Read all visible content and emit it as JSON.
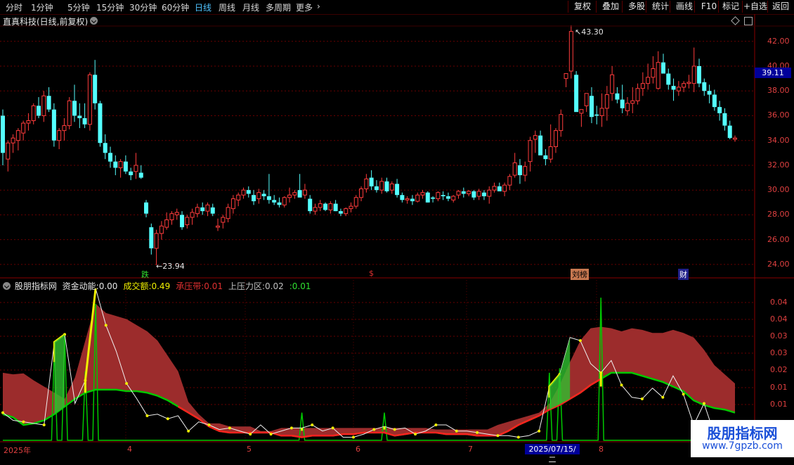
{
  "period_bar": {
    "periods": [
      "分时",
      "1分钟",
      "5分钟",
      "15分钟",
      "30分钟",
      "60分钟",
      "日线",
      "周线",
      "月线",
      "多周期",
      "更多"
    ],
    "active": "日线",
    "right_buttons": [
      "复权",
      "叠加",
      "多股",
      "统计",
      "画线",
      "F10",
      "标记",
      "+自选",
      "返回"
    ]
  },
  "stock": {
    "title": "直真科技(日线,前复权)"
  },
  "price_axis": {
    "ticks": [
      "42.00",
      "40.00",
      "38.00",
      "36.00",
      "34.00",
      "32.00",
      "30.00",
      "28.00",
      "26.00",
      "24.00"
    ],
    "current": "39.11"
  },
  "annotations": {
    "high": "43.30",
    "low": "23.94"
  },
  "events": [
    "跌",
    "$",
    "刘榜",
    "财"
  ],
  "indicator": {
    "name": "股朋指标网",
    "fields": [
      {
        "label": "资金动能:",
        "value": "0.00",
        "color": "#e6e6e6"
      },
      {
        "label": "成交额:",
        "value": "0.49",
        "color": "#f0f000"
      },
      {
        "label": "承压带:",
        "value": "0.01",
        "color": "#e03030"
      },
      {
        "label": "上压力区:",
        "value": "0.02",
        "color": "#c0c0c0"
      },
      {
        "label": ":",
        "value": "0.01",
        "color": "#30e030"
      }
    ],
    "axis_ticks": [
      "0.04",
      "0.04",
      "0.03",
      "0.03",
      "0.02",
      "0.01",
      "0.01"
    ]
  },
  "time_axis": {
    "labels": [
      "2025年",
      "4",
      "5",
      "6",
      "7",
      "8"
    ],
    "cursor_date": "2025/07/15/二"
  },
  "watermark": {
    "title": "股朋指标网",
    "url": "www.7gpzb.com"
  },
  "colors": {
    "up": "#ff3c3c",
    "down": "#54ffff",
    "band": "#9c2c2c",
    "support": "#00c800",
    "zero": "#ff2020",
    "volume": "#f0f000"
  },
  "chart_data": {
    "type": "candlestick",
    "ylim": [
      23.2,
      44.2
    ],
    "ohlc": [
      [
        36.0,
        36.5,
        32.0,
        33.0
      ],
      [
        32.5,
        34.0,
        31.5,
        33.8
      ],
      [
        33.8,
        34.5,
        33.0,
        34.2
      ],
      [
        34.0,
        35.0,
        33.2,
        34.8
      ],
      [
        34.6,
        35.6,
        34.0,
        35.4
      ],
      [
        35.4,
        36.2,
        34.8,
        35.6
      ],
      [
        35.6,
        37.0,
        35.3,
        36.8
      ],
      [
        36.8,
        37.5,
        35.8,
        36.0
      ],
      [
        36.0,
        38.0,
        35.5,
        37.6
      ],
      [
        37.6,
        38.3,
        36.3,
        36.5
      ],
      [
        36.5,
        37.0,
        33.5,
        34.0
      ],
      [
        34.0,
        35.0,
        33.3,
        34.8
      ],
      [
        34.8,
        35.8,
        34.0,
        35.2
      ],
      [
        35.2,
        37.5,
        34.9,
        37.2
      ],
      [
        37.2,
        38.5,
        35.5,
        36.0
      ],
      [
        36.0,
        37.0,
        35.0,
        35.8
      ],
      [
        35.8,
        37.0,
        35.0,
        35.3
      ],
      [
        35.3,
        39.5,
        34.8,
        39.3
      ],
      [
        39.3,
        40.5,
        36.5,
        37.0
      ],
      [
        37.0,
        37.2,
        33.5,
        33.8
      ],
      [
        33.8,
        34.5,
        32.5,
        33.0
      ],
      [
        33.0,
        33.5,
        31.8,
        32.3
      ],
      [
        32.3,
        32.8,
        31.2,
        31.8
      ],
      [
        31.8,
        32.5,
        31.0,
        32.3
      ],
      [
        32.3,
        32.8,
        31.3,
        31.5
      ],
      [
        31.5,
        31.8,
        30.8,
        31.2
      ],
      [
        31.5,
        33.0,
        30.9,
        32.0
      ],
      [
        31.4,
        32.0,
        30.9,
        31.0
      ],
      [
        29.0,
        29.2,
        27.8,
        28.1
      ],
      [
        27.0,
        27.3,
        24.8,
        25.3
      ],
      [
        25.3,
        26.8,
        23.94,
        26.5
      ],
      [
        26.5,
        27.5,
        26.0,
        27.1
      ],
      [
        27.0,
        28.2,
        26.8,
        27.6
      ],
      [
        27.6,
        28.3,
        27.2,
        28.1
      ],
      [
        28.0,
        28.5,
        27.6,
        28.2
      ],
      [
        28.0,
        28.3,
        26.8,
        27.0
      ],
      [
        27.2,
        28.0,
        26.9,
        27.8
      ],
      [
        27.8,
        28.5,
        27.2,
        28.2
      ],
      [
        28.1,
        28.9,
        27.8,
        28.6
      ],
      [
        28.6,
        29.0,
        28.0,
        28.3
      ],
      [
        28.3,
        29.0,
        27.9,
        28.8
      ],
      [
        28.6,
        28.9,
        27.9,
        28.1
      ],
      [
        27.0,
        27.7,
        26.7,
        27.1
      ],
      [
        27.4,
        28.0,
        26.9,
        27.8
      ],
      [
        27.7,
        28.9,
        27.4,
        28.6
      ],
      [
        28.5,
        29.6,
        28.1,
        29.3
      ],
      [
        29.2,
        29.8,
        28.7,
        29.6
      ],
      [
        29.6,
        30.2,
        29.3,
        30.0
      ],
      [
        30.0,
        30.3,
        29.4,
        29.7
      ],
      [
        29.6,
        30.0,
        28.8,
        29.1
      ],
      [
        29.3,
        30.1,
        28.9,
        29.8
      ],
      [
        29.7,
        30.0,
        29.2,
        29.5
      ],
      [
        29.5,
        31.3,
        28.9,
        29.2
      ],
      [
        29.2,
        29.6,
        28.8,
        29.0
      ],
      [
        29.0,
        29.4,
        28.6,
        28.8
      ],
      [
        28.8,
        29.5,
        28.6,
        29.4
      ],
      [
        29.4,
        30.2,
        29.0,
        29.6
      ],
      [
        29.6,
        30.0,
        29.3,
        29.8
      ],
      [
        30.0,
        31.3,
        29.6,
        29.4
      ],
      [
        29.6,
        30.5,
        29.3,
        30.0
      ],
      [
        29.3,
        29.6,
        28.1,
        28.3
      ],
      [
        28.3,
        28.9,
        28.0,
        28.6
      ],
      [
        28.6,
        29.2,
        28.3,
        28.9
      ],
      [
        28.9,
        29.0,
        28.3,
        28.4
      ],
      [
        28.4,
        29.1,
        28.1,
        28.9
      ],
      [
        28.9,
        29.2,
        28.3,
        28.3
      ],
      [
        28.3,
        28.5,
        27.9,
        28.1
      ],
      [
        28.1,
        28.6,
        27.9,
        28.5
      ],
      [
        28.5,
        29.0,
        28.2,
        28.7
      ],
      [
        28.7,
        29.6,
        28.5,
        29.4
      ],
      [
        29.4,
        30.3,
        29.1,
        30.1
      ],
      [
        30.1,
        31.3,
        29.8,
        30.9
      ],
      [
        31.0,
        31.6,
        30.0,
        30.3
      ],
      [
        30.3,
        30.8,
        29.8,
        30.0
      ],
      [
        30.0,
        31.0,
        29.7,
        30.7
      ],
      [
        30.7,
        31.0,
        29.8,
        29.9
      ],
      [
        30.0,
        30.7,
        29.7,
        30.5
      ],
      [
        30.5,
        30.9,
        29.4,
        29.6
      ],
      [
        29.6,
        29.8,
        29.0,
        29.2
      ],
      [
        29.2,
        29.5,
        28.9,
        29.3
      ],
      [
        29.3,
        29.6,
        28.8,
        29.1
      ],
      [
        29.1,
        29.8,
        29.0,
        29.6
      ],
      [
        29.6,
        30.0,
        29.3,
        29.8
      ],
      [
        29.8,
        29.9,
        29.0,
        29.0
      ],
      [
        29.4,
        29.5,
        29.0,
        29.3
      ],
      [
        29.3,
        29.9,
        29.1,
        29.8
      ],
      [
        29.6,
        29.9,
        29.2,
        29.5
      ],
      [
        29.5,
        29.8,
        29.1,
        29.3
      ],
      [
        29.2,
        29.6,
        29.0,
        29.5
      ],
      [
        29.6,
        30.0,
        29.3,
        29.9
      ],
      [
        29.9,
        30.2,
        29.4,
        29.7
      ],
      [
        29.7,
        30.0,
        29.5,
        29.9
      ],
      [
        29.9,
        30.0,
        29.2,
        29.4
      ],
      [
        29.5,
        30.1,
        29.2,
        29.9
      ],
      [
        29.8,
        30.0,
        29.2,
        29.5
      ],
      [
        29.5,
        30.3,
        28.9,
        30.0
      ],
      [
        30.0,
        30.6,
        29.8,
        30.3
      ],
      [
        30.3,
        30.6,
        29.9,
        29.9
      ],
      [
        29.9,
        30.6,
        29.5,
        30.4
      ],
      [
        30.4,
        31.3,
        30.0,
        31.1
      ],
      [
        31.2,
        33.0,
        31.0,
        32.2
      ],
      [
        32.0,
        32.5,
        30.5,
        31.2
      ],
      [
        31.2,
        32.3,
        30.7,
        31.9
      ],
      [
        32.3,
        34.3,
        31.5,
        34.0
      ],
      [
        34.1,
        34.8,
        33.0,
        34.4
      ],
      [
        34.4,
        34.8,
        33.5,
        32.8
      ],
      [
        32.8,
        33.3,
        32.0,
        32.5
      ],
      [
        32.5,
        35.3,
        32.2,
        33.5
      ],
      [
        33.5,
        35.0,
        33.0,
        34.8
      ],
      [
        34.8,
        36.5,
        34.3,
        36.1
      ],
      [
        39.0,
        39.3,
        38.3,
        39.4
      ],
      [
        39.6,
        43.3,
        39.0,
        42.8
      ],
      [
        39.3,
        39.6,
        37.8,
        36.3
      ],
      [
        36.2,
        36.5,
        35.1,
        36.5
      ],
      [
        36.8,
        37.5,
        36.3,
        37.8
      ],
      [
        37.6,
        38.3,
        35.4,
        35.9
      ],
      [
        36.1,
        36.8,
        35.3,
        36.0
      ],
      [
        36.0,
        37.8,
        35.1,
        36.6
      ],
      [
        36.6,
        38.4,
        35.6,
        37.7
      ],
      [
        37.8,
        40.0,
        37.2,
        39.3
      ],
      [
        37.8,
        38.3,
        37.0,
        37.3
      ],
      [
        37.3,
        38.5,
        36.2,
        36.6
      ],
      [
        36.4,
        37.5,
        36.0,
        37.0
      ],
      [
        37.0,
        38.3,
        36.2,
        37.2
      ],
      [
        37.2,
        38.6,
        36.9,
        38.2
      ],
      [
        38.2,
        39.5,
        37.6,
        38.6
      ],
      [
        38.6,
        40.2,
        38.1,
        39.1
      ],
      [
        39.1,
        40.8,
        38.6,
        39.8
      ],
      [
        38.2,
        41.2,
        38.1,
        40.3
      ],
      [
        40.3,
        41.0,
        39.6,
        39.4
      ],
      [
        39.4,
        39.8,
        38.1,
        38.5
      ],
      [
        38.4,
        39.0,
        37.2,
        38.1
      ],
      [
        38.0,
        38.8,
        37.6,
        38.3
      ],
      [
        38.3,
        38.8,
        37.9,
        38.6
      ],
      [
        38.6,
        39.3,
        38.2,
        38.7
      ],
      [
        38.6,
        41.5,
        37.9,
        40.0
      ],
      [
        40.0,
        40.6,
        38.3,
        38.6
      ],
      [
        38.7,
        39.0,
        37.6,
        38.0
      ],
      [
        38.0,
        38.5,
        37.0,
        37.7
      ],
      [
        37.7,
        38.1,
        36.4,
        36.7
      ],
      [
        36.7,
        37.2,
        35.6,
        36.2
      ],
      [
        36.2,
        36.6,
        34.8,
        35.2
      ],
      [
        35.2,
        35.6,
        34.1,
        34.2
      ],
      [
        34.1,
        34.4,
        33.9,
        34.2
      ]
    ],
    "indicator": {
      "ylim": [
        0.0,
        0.05
      ],
      "band_top": [
        0.0225,
        0.022,
        0.0223,
        0.02,
        0.018,
        0.016,
        0.014,
        0.021,
        0.033,
        0.045,
        0.042,
        0.041,
        0.04,
        0.038,
        0.036,
        0.033,
        0.028,
        0.023,
        0.013,
        0.009,
        0.006,
        0.006,
        0.005,
        0.005,
        0.005,
        0.0035,
        0.0035,
        0.0045,
        0.0045,
        0.0045,
        0.0045,
        0.0045,
        0.0045,
        0.0045,
        0.0045,
        0.0045,
        0.0045,
        0.0045,
        0.0045,
        0.0045,
        0.0045,
        0.0045,
        0.004,
        0.004,
        0.004,
        0.004,
        0.004,
        0.004,
        0.0055,
        0.0065,
        0.0075,
        0.0085,
        0.0095,
        0.0125,
        0.0185,
        0.026,
        0.033,
        0.037,
        0.0375,
        0.037,
        0.036,
        0.037,
        0.0365,
        0.0355,
        0.0355,
        0.0365,
        0.0355,
        0.034,
        0.03,
        0.025,
        0.022,
        0.019
      ],
      "band_bottom": [
        0.009,
        0.008,
        0.0055,
        0.006,
        0.007,
        0.009,
        0.0115,
        0.014,
        0.016,
        0.017,
        0.017,
        0.017,
        0.0165,
        0.0165,
        0.016,
        0.015,
        0.0135,
        0.0115,
        0.0095,
        0.0075,
        0.005,
        0.0035,
        0.003,
        0.003,
        0.003,
        0.003,
        0.003,
        0.002,
        0.002,
        0.0015,
        0.002,
        0.002,
        0.002,
        0.0025,
        0.0025,
        0.003,
        0.003,
        0.003,
        0.002,
        0.0025,
        0.003,
        0.003,
        0.003,
        0.0025,
        0.0025,
        0.0025,
        0.002,
        0.002,
        0.002,
        0.0035,
        0.0055,
        0.007,
        0.0085,
        0.0105,
        0.012,
        0.014,
        0.016,
        0.0185,
        0.0205,
        0.0225,
        0.0225,
        0.0225,
        0.0215,
        0.0205,
        0.0195,
        0.018,
        0.0165,
        0.0135,
        0.012,
        0.011,
        0.0105,
        0.0095
      ],
      "fund_line": [
        0.0095,
        0.007,
        0.0065,
        0.006,
        0.0055,
        0.0325,
        0.035,
        0.0125,
        0.02,
        0.05,
        0.038,
        0.0295,
        0.019,
        0.014,
        0.0085,
        0.009,
        0.0075,
        0.0085,
        0.0035,
        0.0065,
        0.0055,
        0.004,
        0.0045,
        0.0035,
        0.0025,
        0.0055,
        0.0025,
        0.0035,
        0.0045,
        0.0045,
        0.0055,
        0.0035,
        0.0045,
        0.0015,
        0.0015,
        0.0025,
        0.004,
        0.005,
        0.004,
        0.0045,
        0.0025,
        0.0035,
        0.0055,
        0.0055,
        0.0035,
        0.0035,
        0.003,
        0.0025,
        0.002,
        0.002,
        0.0015,
        0.002,
        0.0035,
        0.018,
        0.022,
        0.034,
        0.033,
        0.0255,
        0.0225,
        0.0265,
        0.0185,
        0.0145,
        0.014,
        0.0175,
        0.0145,
        0.0215,
        0.0155,
        0.0055,
        0.0125,
        0.0025,
        0.0035,
        0.002
      ],
      "support_spikes": [
        0.031,
        0.035,
        0.023,
        0.045,
        0.0095,
        0.0095,
        0.0225,
        0.024,
        0.047
      ],
      "volume_segments": 11
    }
  }
}
